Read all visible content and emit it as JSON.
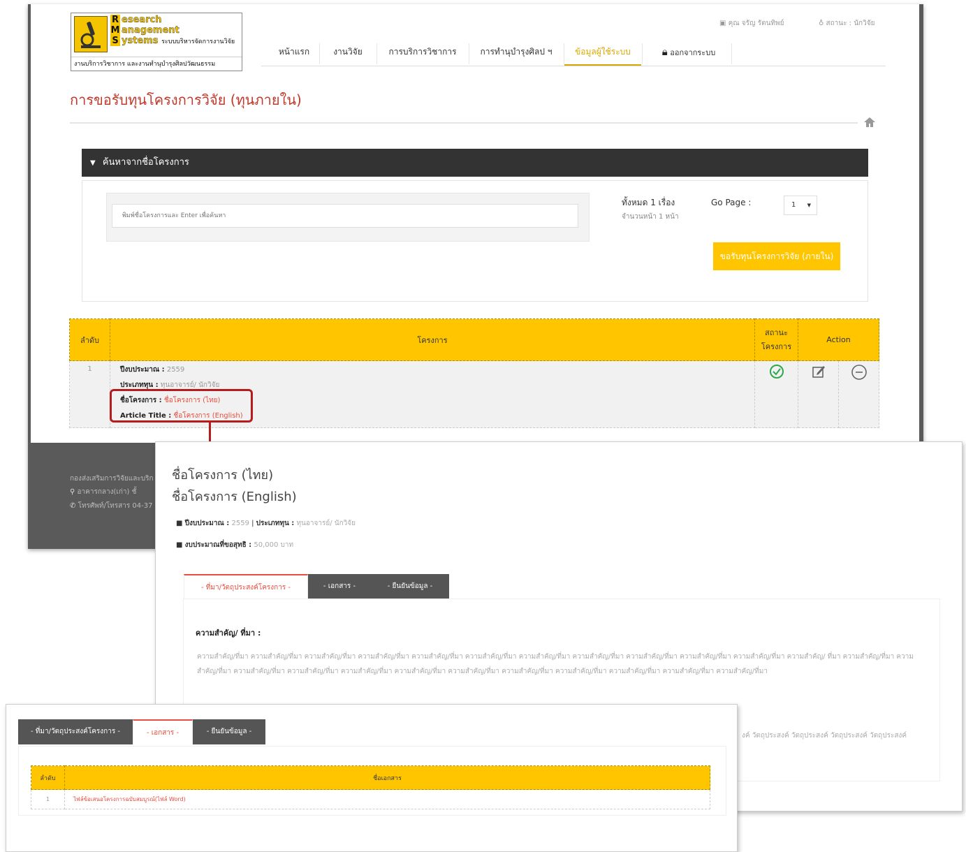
{
  "logo": {
    "line1_initial": "R",
    "line1_rest": "esearch",
    "line2_initial": "M",
    "line2_rest": "anagement",
    "line3_initial": "S",
    "line3_rest": "ystems",
    "line3_sub": "ระบบบริหารจัดการงานวิจัย",
    "bottom": "งานบริการวิชาการ และงานทำนุบำรุงศิลปวัฒนธรรม"
  },
  "top_user": {
    "name": "คุณ จรัญ รัตนทิพย์",
    "status": "สถานะ : นักวิจัย"
  },
  "nav": [
    "หน้าแรก",
    "งานวิจัย",
    "การบริการวิชาการ",
    "การทำนุบำรุงศิลป ฯ",
    "ข้อมูลผู้ใช้ระบบ",
    "ออกจากระบบ"
  ],
  "page_title": "การขอรับทุนโครงการวิจัย (ทุนภายใน)",
  "search": {
    "bar_label": "ค้นหาจากชื่อโครงการ",
    "placeholder": "พิมพ์ชื่อโครงการและ Enter เพื่อค้นหา",
    "total": "ทั้งหมด 1 เรื่อง",
    "pages": "จำนวนหน้า 1 หน้า",
    "go_page": "Go Page :",
    "page_value": "1",
    "request_button": "ขอรับทุนโครงการวิจัย (ภายใน)"
  },
  "table": {
    "headers": {
      "no": "ลำดับ",
      "project": "โครงการ",
      "status_line1": "สถานะ",
      "status_line2": "โครงการ",
      "action": "Action"
    },
    "row": {
      "no": "1",
      "year_label": "ปีงบประมาณ :",
      "year": "2559",
      "type_label": "ประเภททุน :",
      "type": "ทุนอาจารย์/ นักวิจัย",
      "name_label": "ชื่อโครงการ :",
      "name": "ชื่อโครงการ (ไทย)",
      "article_label": "Article Title :",
      "article": "ชื่อโครงการ (English)"
    }
  },
  "footer": {
    "line1": "กองส่งเสริมการวิจัยและบริก",
    "line2": "อาคารกลาง(เก่า) ชั้",
    "line3": "โทรศัพท์/โทรสาร 04-37"
  },
  "detail": {
    "title_th": "ชื่อโครงการ (ไทย)",
    "title_en": "ชื่อโครงการ (English)",
    "year_label": "ปีงบประมาณ :",
    "year": "2559",
    "type_label": "ประเภททุน :",
    "type": "ทุนอาจารย์/ นักวิจัย",
    "budget_label": "งบประมาณที่ขอสุทธิ :",
    "budget": "50,000 บาท",
    "tabs": [
      "- ที่มา/วัตถุประสงค์โครงการ -",
      "- เอกสาร -",
      "- ยืนยันข้อมูล -"
    ],
    "importance_label": "ความสำคัญ/ ที่มา :",
    "importance_text": "ความสำคัญ/ที่มา ความสำคัญ/ที่มา ความสำคัญ/ที่มา ความสำคัญ/ที่มา ความสำคัญ/ที่มา ความสำคัญ/ที่มา ความสำคัญ/ที่มา ความสำคัญ/ที่มา ความสำคัญ/ที่มา ความสำคัญ/ที่มา ความสำคัญ/ที่มา ความสำคัญ/ ที่มา ความสำคัญ/ที่มา ความสำคัญ/ที่มา ความสำคัญ/ที่มา ความสำคัญ/ที่มา ความสำคัญ/ที่มา ความสำคัญ/ที่มา ความสำคัญ/ที่มา ความสำคัญ/ที่มา ความสำคัญ/ที่มา ความสำคัญ/ที่มา ความสำคัญ/ที่มา ความสำคัญ/ที่มา",
    "objective_text": "งค์ วัตถุประสงค์ วัตถุประสงค์ วัตถุประสงค์ วัตถุประสงค์"
  },
  "docs": {
    "tabs": [
      "- ที่มา/วัตถุประสงค์โครงการ -",
      "- เอกสาร -",
      "- ยืนยันข้อมูล -"
    ],
    "headers": {
      "no": "ลำดับ",
      "name": "ชื่อเอกสาร"
    },
    "rows": [
      {
        "no": "1",
        "name": "ไฟล์ข้อเสนอโครงการฉบับสมบูรณ์(ไฟล์ Word)"
      }
    ]
  }
}
